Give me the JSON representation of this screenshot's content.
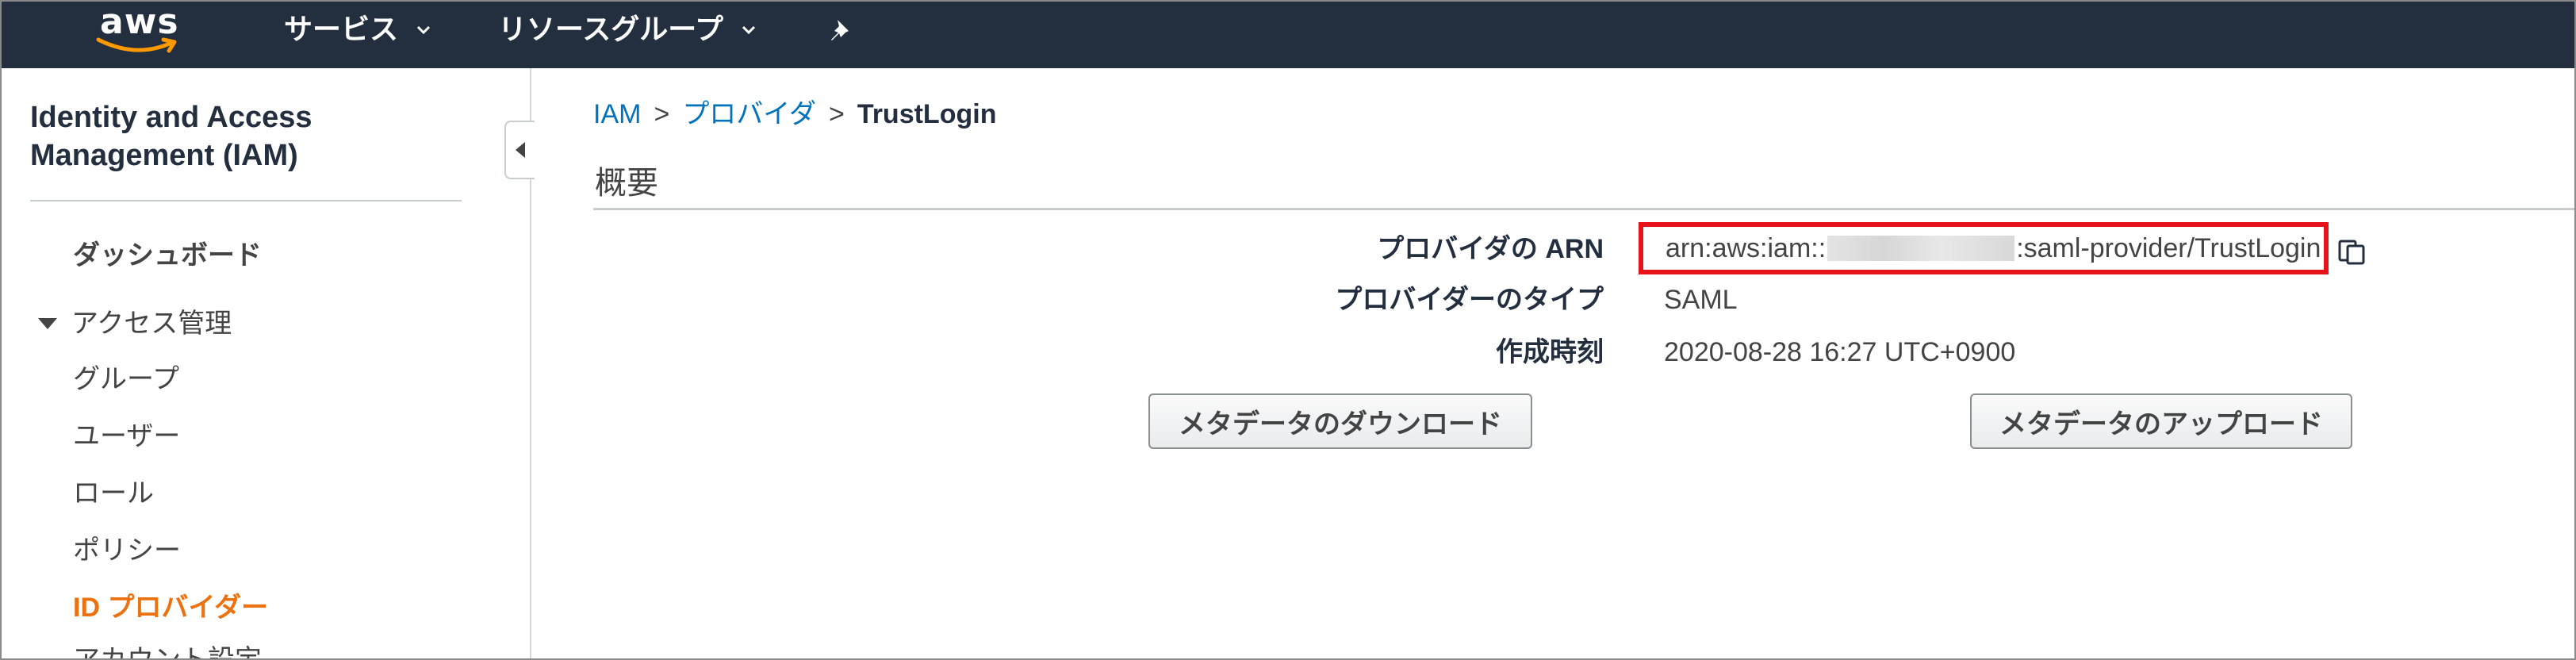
{
  "topbar": {
    "logo_text": "aws",
    "services_label": "サービス",
    "resource_groups_label": "リソースグループ",
    "icons": [
      "chevron-down-icon",
      "pin-icon"
    ]
  },
  "sidebar": {
    "title": "Identity and Access Management (IAM)",
    "dashboard": "ダッシュボード",
    "section_access": "アクセス管理",
    "items": [
      {
        "label": "グループ"
      },
      {
        "label": "ユーザー"
      },
      {
        "label": "ロール"
      },
      {
        "label": "ポリシー"
      },
      {
        "label": "ID プロバイダー",
        "active": true
      },
      {
        "label": "アカウント設定"
      }
    ]
  },
  "breadcrumb": {
    "root": "IAM",
    "sep": ">",
    "providers": "プロバイダ",
    "current": "TrustLogin"
  },
  "summary": {
    "title": "概要",
    "fields": {
      "arn_label": "プロバイダの ARN",
      "arn_prefix": "arn:aws:iam::",
      "arn_suffix": ":saml-provider/TrustLogin",
      "type_label": "プロバイダーのタイプ",
      "type_value": "SAML",
      "created_label": "作成時刻",
      "created_value": "2020-08-28 16:27 UTC+0900"
    },
    "buttons": {
      "download": "メタデータのダウンロード",
      "upload": "メタデータのアップロード"
    }
  },
  "colors": {
    "nav_bg": "#232f3e",
    "link": "#0073bb",
    "active": "#ec7211",
    "highlight_box": "#e8121b"
  }
}
